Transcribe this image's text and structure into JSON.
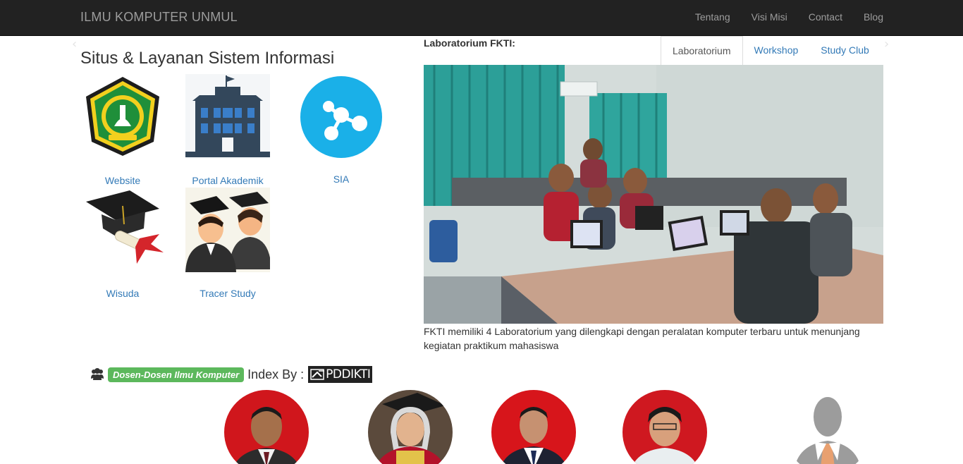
{
  "navbar": {
    "brand": "ILMU KOMPUTER UNMUL",
    "links": [
      "Tentang",
      "Visi Misi",
      "Contact",
      "Blog"
    ]
  },
  "services": {
    "title": "Situs & Layanan Sistem Informasi",
    "items": [
      {
        "label": "Website",
        "icon": "university-logo-icon"
      },
      {
        "label": "Portal Akademik",
        "icon": "building-icon"
      },
      {
        "label": "SIA",
        "icon": "share-network-icon"
      },
      {
        "label": "Wisuda",
        "icon": "graduation-cap-icon"
      },
      {
        "label": "Tracer Study",
        "icon": "graduates-icon"
      }
    ]
  },
  "lab": {
    "title": "Laboratorium FKTI:",
    "tabs": [
      "Laboratorium",
      "Workshop",
      "Study Club"
    ],
    "active_tab": "Laboratorium",
    "caption": "FKTI memiliki 4 Laboratorium yang dilengkapi dengan peralatan komputer terbaru untuk menunjang kegiatan praktikum mahasiswa"
  },
  "dosen": {
    "badge": "Dosen-Dosen Ilmu Komputer",
    "index_by": "Index By :",
    "logo_text": "PDDIKTI"
  },
  "colors": {
    "navbar_bg": "#222222",
    "link": "#337ab7",
    "badge": "#5cb85c",
    "sia_circle": "#1ab0e8"
  }
}
